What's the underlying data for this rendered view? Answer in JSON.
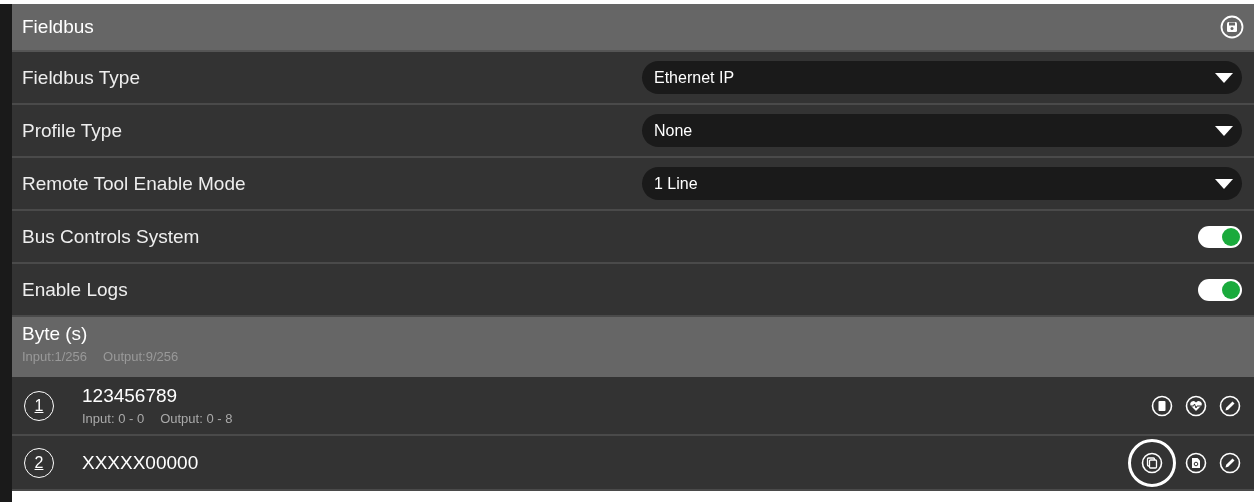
{
  "panel": {
    "title": "Fieldbus"
  },
  "settings": [
    {
      "kind": "dropdown",
      "label": "Fieldbus Type",
      "value": "Ethernet IP"
    },
    {
      "kind": "dropdown",
      "label": "Profile Type",
      "value": "None"
    },
    {
      "kind": "dropdown",
      "label": "Remote Tool Enable Mode",
      "value": "1 Line"
    },
    {
      "kind": "toggle",
      "label": "Bus Controls System",
      "on": true
    },
    {
      "kind": "toggle",
      "label": "Enable Logs",
      "on": true
    }
  ],
  "bytes": {
    "title": "Byte (s)",
    "input_total": "Input:1/256",
    "output_total": "Output:9/256",
    "items": [
      {
        "number": "1",
        "name": "123456789",
        "input": "Input: 0 - 0",
        "output": "Output: 0 - 8",
        "actions": [
          {
            "kind": "delete",
            "highlighted": false
          },
          {
            "kind": "heart",
            "highlighted": false
          },
          {
            "kind": "edit",
            "highlighted": false
          }
        ]
      },
      {
        "number": "2",
        "name": "XXXXX00000",
        "actions": [
          {
            "kind": "copy",
            "highlighted": true
          },
          {
            "kind": "document",
            "highlighted": false
          },
          {
            "kind": "edit",
            "highlighted": false
          }
        ]
      }
    ]
  }
}
